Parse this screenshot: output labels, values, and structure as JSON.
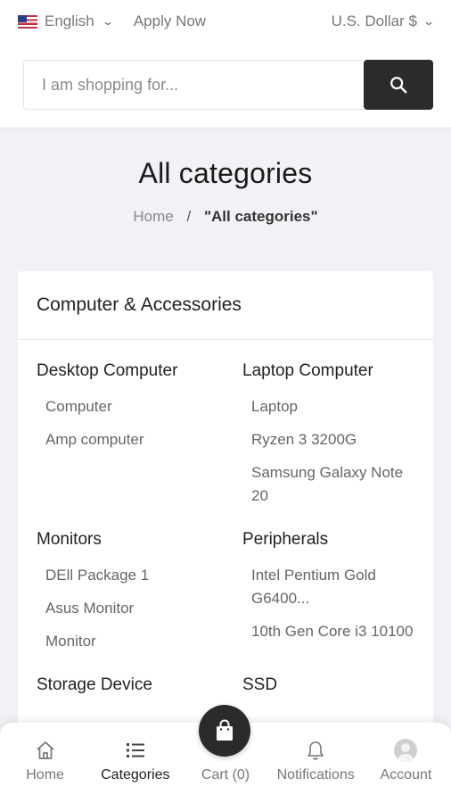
{
  "topbar": {
    "language": "English",
    "apply_now": "Apply Now",
    "currency": "U.S. Dollar $"
  },
  "search": {
    "placeholder": "I am shopping for...",
    "value": ""
  },
  "page": {
    "title": "All categories",
    "breadcrumb_home": "Home",
    "breadcrumb_sep": "/",
    "breadcrumb_current": "\"All categories\""
  },
  "category": {
    "name": "Computer & Accessories",
    "groups": [
      {
        "title": "Desktop Computer",
        "items": [
          "Computer",
          "Amp computer"
        ]
      },
      {
        "title": "Laptop Computer",
        "items": [
          "Laptop",
          "Ryzen 3 3200G",
          "Samsung Galaxy Note 20"
        ]
      },
      {
        "title": "Monitors",
        "items": [
          "DEll Package 1",
          "Asus Monitor",
          "Monitor"
        ]
      },
      {
        "title": "Peripherals",
        "items": [
          "Intel Pentium Gold G6400...",
          "10th Gen Core i3 10100"
        ]
      },
      {
        "title": "Storage Device",
        "items": []
      },
      {
        "title": "SSD",
        "items": []
      }
    ]
  },
  "bottom_nav": {
    "home": "Home",
    "categories": "Categories",
    "cart": "Cart (0)",
    "notifications": "Notifications",
    "account": "Account"
  },
  "icons": {
    "flag": "us-flag-icon",
    "search": "search-icon",
    "home": "home-icon",
    "categories": "list-icon",
    "cart": "shopping-bag-icon",
    "notifications": "bell-icon",
    "account": "user-avatar-icon"
  },
  "colors": {
    "accent": "#2b2b2b",
    "background": "#f1f2f5"
  }
}
